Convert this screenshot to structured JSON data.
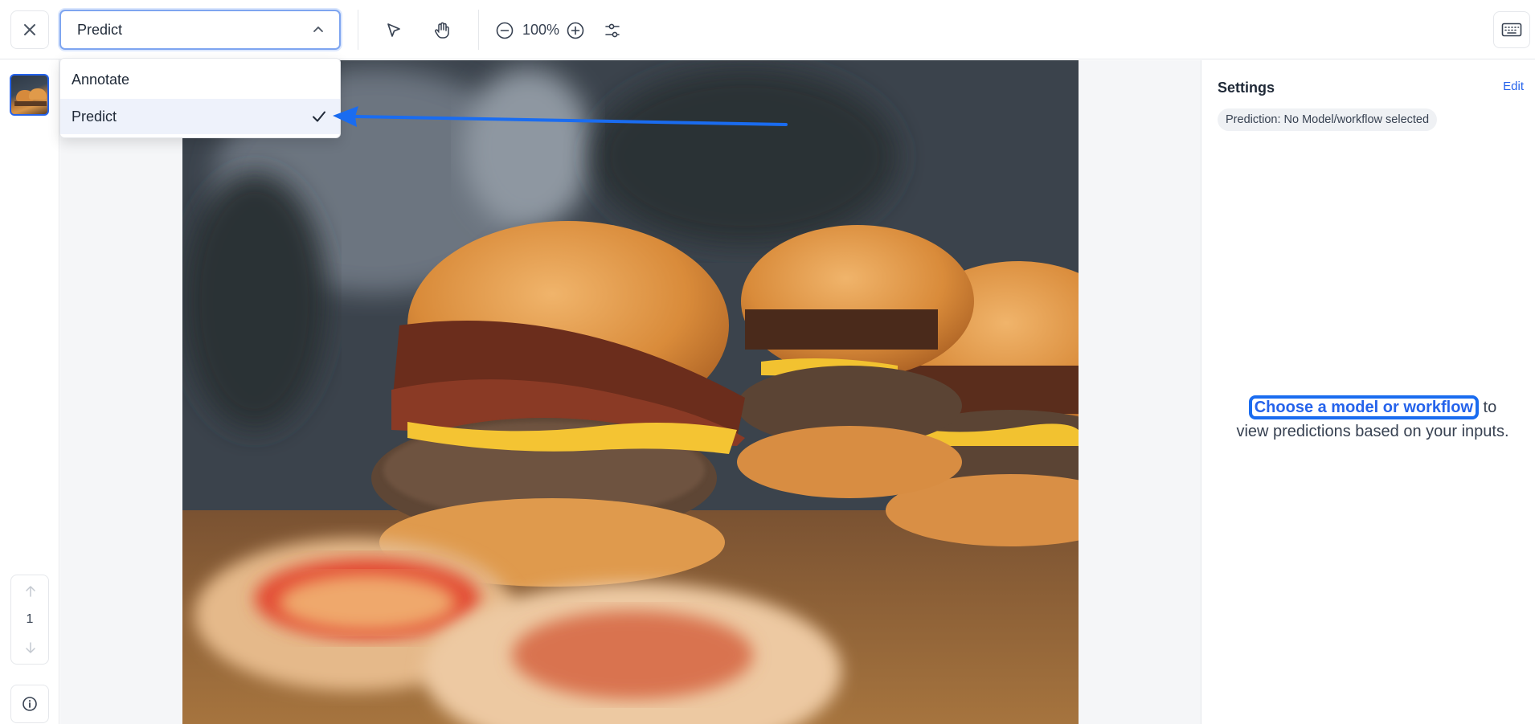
{
  "toolbar": {
    "mode_value": "Predict",
    "zoom_level": "100%",
    "icons": [
      "close-icon",
      "chevron-up-icon",
      "select-pointer-icon",
      "hand-pan-icon",
      "zoom-out-icon",
      "zoom-in-icon",
      "adjustments-icon",
      "keyboard-icon"
    ]
  },
  "mode_menu": {
    "items": [
      {
        "label": "Annotate",
        "selected": false
      },
      {
        "label": "Predict",
        "selected": true
      }
    ]
  },
  "left_rail": {
    "page_number": "1"
  },
  "settings_panel": {
    "title": "Settings",
    "edit_label": "Edit",
    "prediction_chip": "Prediction: No Model/workflow selected",
    "cta_link": "Choose a model or workflow",
    "cta_text_rest": " to view predictions based on your inputs."
  },
  "colors": {
    "accent": "#2563eb",
    "annotation_blue": "#1a6cf0"
  }
}
